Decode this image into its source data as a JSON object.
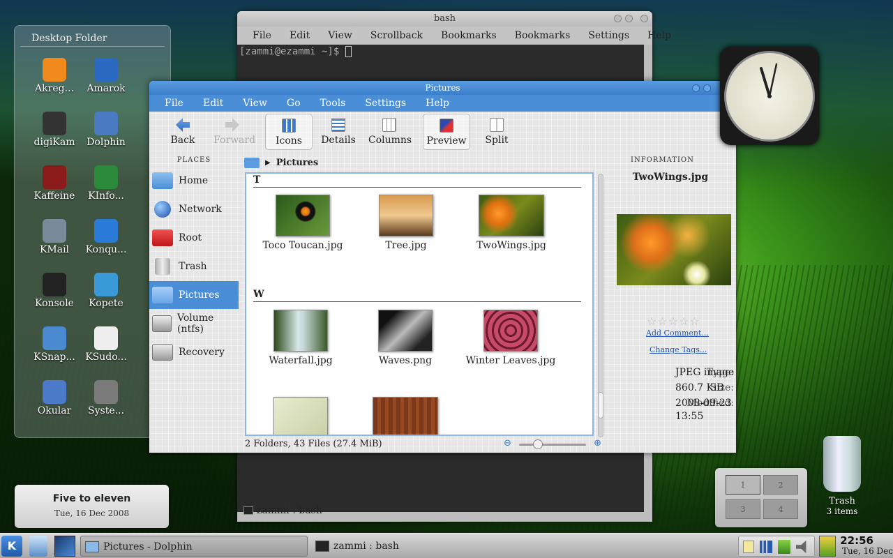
{
  "desktop_folder": {
    "title": "Desktop Folder",
    "icons": [
      {
        "label": "Akreg...",
        "icon": "rss-icon",
        "color": "#f08a1c"
      },
      {
        "label": "Amarok",
        "icon": "wolf-icon",
        "color": "#2a6ac0"
      },
      {
        "label": "digiKam",
        "icon": "camera-icon",
        "color": "#333333"
      },
      {
        "label": "Dolphin",
        "icon": "file-manager-icon",
        "color": "#4a7bc2"
      },
      {
        "label": "Kaffeine",
        "icon": "clapperboard-icon",
        "color": "#8b1a1a"
      },
      {
        "label": "KInfo...",
        "icon": "circuit-icon",
        "color": "#2a8a3a"
      },
      {
        "label": "KMail",
        "icon": "mail-icon",
        "color": "#7a8a9a"
      },
      {
        "label": "Konqu...",
        "icon": "globe-icon",
        "color": "#2a7ad8"
      },
      {
        "label": "Konsole",
        "icon": "terminal-icon",
        "color": "#222222"
      },
      {
        "label": "Kopete",
        "icon": "chat-icon",
        "color": "#3a9ad8"
      },
      {
        "label": "KSnap...",
        "icon": "monitor-icon",
        "color": "#4a8ad0"
      },
      {
        "label": "KSudo...",
        "icon": "sudoku-icon",
        "color": "#eeeeee"
      },
      {
        "label": "Okular",
        "icon": "reader-icon",
        "color": "#4a7ac8"
      },
      {
        "label": "Syste...",
        "icon": "tools-icon",
        "color": "#7a7a7a"
      }
    ]
  },
  "terminal": {
    "title": "bash",
    "menu": [
      "File",
      "Edit",
      "View",
      "Scrollback",
      "Bookmarks",
      "Bookmarks",
      "Settings",
      "Help"
    ],
    "prompt": "[zammi@ezammi ~]$",
    "tab_label": "zammi : bash"
  },
  "dolphin": {
    "title": "Pictures",
    "menu": [
      "File",
      "Edit",
      "View",
      "Go",
      "Tools",
      "Settings",
      "Help"
    ],
    "toolbar": {
      "back": "Back",
      "forward": "Forward",
      "icons": "Icons",
      "details": "Details",
      "columns": "Columns",
      "preview": "Preview",
      "split": "Split"
    },
    "places_header": "PLACES",
    "places": [
      "Home",
      "Network",
      "Root",
      "Trash",
      "Pictures",
      "Volume (ntfs)",
      "Recovery"
    ],
    "breadcrumb": "Pictures",
    "groups": [
      {
        "letter": "T",
        "files": [
          "Toco Toucan.jpg",
          "Tree.jpg",
          "TwoWings.jpg"
        ]
      },
      {
        "letter": "W",
        "files": [
          "Waterfall.jpg",
          "Waves.png",
          "Winter Leaves.jpg"
        ]
      }
    ],
    "status": "2 Folders, 43 Files (27.4 MiB)",
    "information": {
      "header": "INFORMATION",
      "filename": "TwoWings.jpg",
      "add_comment": "Add Comment...",
      "change_tags": "Change Tags...",
      "type_label": "Type:",
      "type_value": "JPEG image",
      "size_label": "Size:",
      "size_value": "860.7 KiB",
      "modified_label": "Modified:",
      "modified_date": "2008-09-23",
      "modified_time": "13:55",
      "rating_stars": 0,
      "stars_glyph": "☆☆☆☆☆"
    }
  },
  "date_widget": {
    "line1": "Five to eleven",
    "line2": "Tue, 16 Dec 2008"
  },
  "pager": {
    "desktops": [
      "1",
      "2",
      "3",
      "4"
    ],
    "active": "1"
  },
  "trash": {
    "label": "Trash",
    "count": "3 items"
  },
  "taskbar": {
    "kmenu": "K",
    "tasks": [
      "Pictures - Dolphin",
      "zammi : bash"
    ],
    "time": "22:56",
    "date": "Tue, 16 Dec"
  }
}
